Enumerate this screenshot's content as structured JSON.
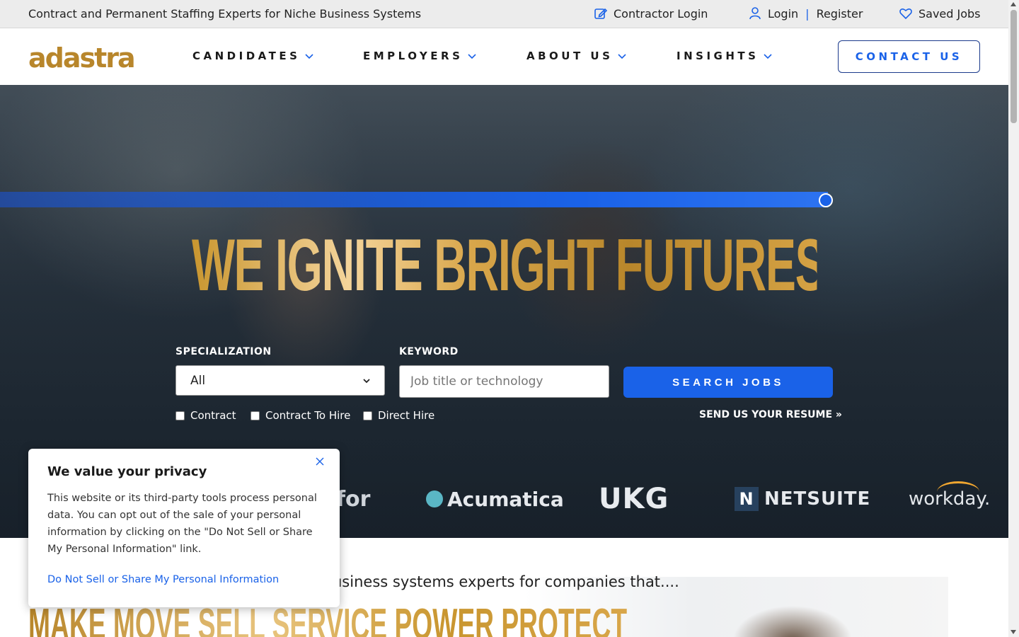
{
  "topbar": {
    "tagline": "Contract and Permanent Staffing Experts for Niche Business Systems",
    "contractor_login": "Contractor Login",
    "login": "Login",
    "separator": "|",
    "register": "Register",
    "saved_jobs": "Saved Jobs"
  },
  "nav": {
    "logo": "adastra",
    "items": [
      {
        "label": "CANDIDATES"
      },
      {
        "label": "EMPLOYERS"
      },
      {
        "label": "ABOUT US"
      },
      {
        "label": "INSIGHTS"
      }
    ],
    "contact": "CONTACT US"
  },
  "hero": {
    "headline": "WE IGNITE BRIGHT FUTURES",
    "specialization_label": "SPECIALIZATION",
    "specialization_value": "All",
    "keyword_label": "KEYWORD",
    "keyword_placeholder": "Job title or technology",
    "search_button": "SEARCH JOBS",
    "checkboxes": [
      {
        "label": "Contract",
        "checked": false
      },
      {
        "label": "Contract To Hire",
        "checked": false
      },
      {
        "label": "Direct Hire",
        "checked": false
      }
    ],
    "resume_link": "SEND US YOUR RESUME »",
    "partner_logos": [
      "for",
      "Acumatica",
      "UKG",
      "NETSUITE",
      "workday."
    ]
  },
  "intro": {
    "text": "usiness systems experts for companies that....",
    "verbs": "MAKE MOVE SELL SERVICE POWER PROTECT"
  },
  "cookie": {
    "title": "We value your privacy",
    "body": "This website or its third-party tools process personal data. You can opt out of the sale of your personal information by clicking on the \"Do Not Sell or Share My Personal Information\" link.",
    "link": "Do Not Sell or Share My Personal Information"
  },
  "colors": {
    "brand_gold": "#b8862b",
    "accent_blue": "#1a62e8",
    "topbar_bg": "#ececec"
  },
  "icons": [
    "edit-icon",
    "user-icon",
    "heart-icon",
    "chevron-down-icon",
    "close-icon"
  ]
}
